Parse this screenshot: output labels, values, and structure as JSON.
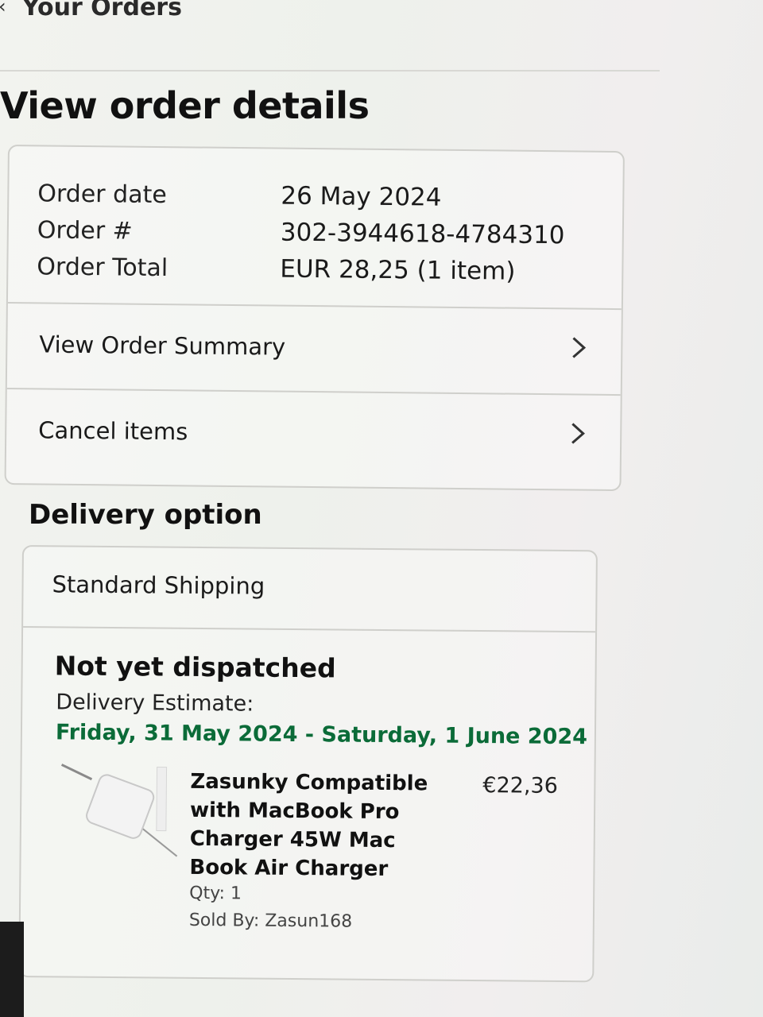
{
  "nav": {
    "back_label": "Your Orders"
  },
  "page": {
    "title": "View order details"
  },
  "order": {
    "rows": [
      {
        "label": "Order date",
        "value": "26 May 2024"
      },
      {
        "label": "Order #",
        "value": "302-3944618-4784310"
      },
      {
        "label": "Order Total",
        "value": "EUR 28,25 (1 item)"
      }
    ],
    "actions": {
      "summary_label": "View Order Summary",
      "cancel_label": "Cancel items"
    }
  },
  "delivery": {
    "section_title": "Delivery option",
    "method": "Standard Shipping",
    "status": "Not yet dispatched",
    "estimate_label": "Delivery Estimate:",
    "estimate_range": "Friday, 31 May 2024 - Saturday, 1 June 2024",
    "estimate_color": "#0b6b38"
  },
  "item": {
    "name": "Zasunky Compatible with MacBook Pro Charger 45W Mac Book Air Charger",
    "price": "€22,36",
    "qty": "Qty: 1",
    "seller": "Sold By: Zasun168",
    "image_icon": "charger-image"
  }
}
